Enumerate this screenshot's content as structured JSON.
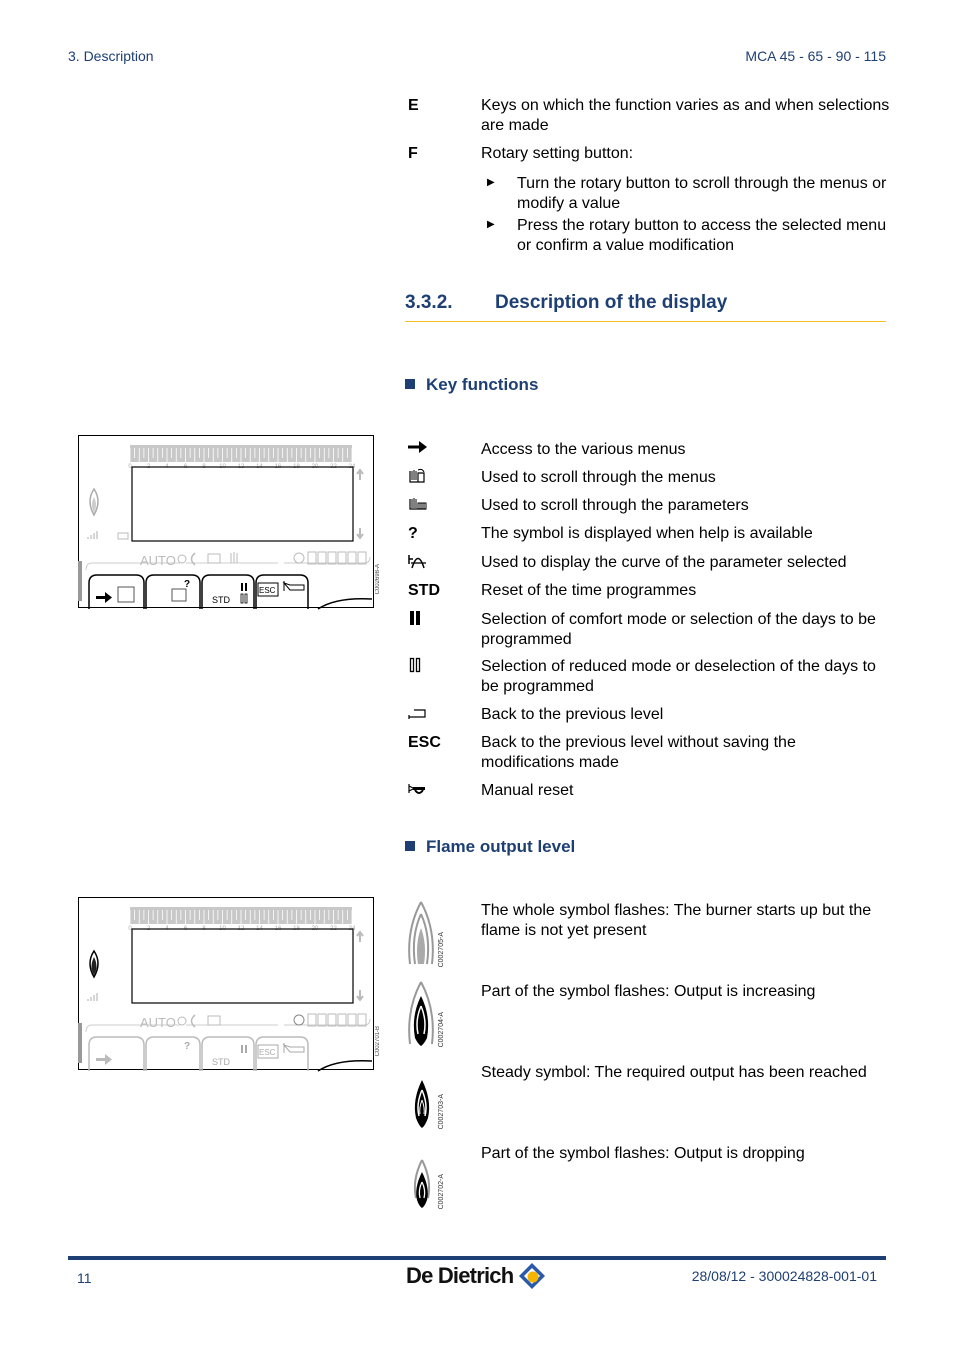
{
  "header": {
    "section": "3.  Description",
    "model": "MCA 45 - 65 - 90 - 115"
  },
  "top_items": [
    {
      "key": "E",
      "text": "Keys on which the function varies as and when selections are made"
    },
    {
      "key": "F",
      "text": "Rotary setting button:"
    }
  ],
  "rotary_bullets": [
    "Turn the rotary button to scroll through the menus or modify a value",
    "Press the rotary button to access the selected menu or confirm a value modification"
  ],
  "section_heading": {
    "number": "3.3.2.",
    "title": "Description of the display"
  },
  "key_functions": {
    "title": "Key functions",
    "items": [
      {
        "symbol": "arrow-right-icon",
        "label": "",
        "text": "Access to the various menus"
      },
      {
        "symbol": "scroll-menus-icon",
        "label": "",
        "text": "Used to scroll through the menus"
      },
      {
        "symbol": "scroll-parameters-icon",
        "label": "",
        "text": "Used to scroll through the parameters"
      },
      {
        "symbol": "help-icon",
        "label": "?",
        "text": "The symbol is displayed when help is available"
      },
      {
        "symbol": "curve-icon",
        "label": "",
        "text": "Used to display the curve of the parameter selected"
      },
      {
        "symbol": "std-label",
        "label": "STD",
        "text": "Reset of the time programmes"
      },
      {
        "symbol": "comfort-mode-icon",
        "label": "",
        "text": "Selection of comfort mode or selection of the days to be programmed"
      },
      {
        "symbol": "reduced-mode-icon",
        "label": "",
        "text": "Selection of reduced mode or deselection of the days to be programmed"
      },
      {
        "symbol": "back-icon",
        "label": "",
        "text": "Back to the previous level"
      },
      {
        "symbol": "esc-label",
        "label": "ESC",
        "text": "Back to the previous level without saving the modifications made"
      },
      {
        "symbol": "manual-reset-icon",
        "label": "",
        "text": "Manual reset"
      }
    ]
  },
  "display_panel_1": {
    "time_ticks": [
      "0",
      "2",
      "4",
      "6",
      "8",
      "10",
      "12",
      "14",
      "16",
      "18",
      "20",
      "22",
      "24"
    ],
    "mode_text": "AUTO",
    "buttons": [
      "",
      "?",
      "STD",
      "ESC"
    ],
    "caption": "C002698-A"
  },
  "display_panel_2": {
    "time_ticks": [
      "0",
      "2",
      "4",
      "6",
      "8",
      "10",
      "12",
      "14",
      "16",
      "18",
      "20",
      "22",
      "24"
    ],
    "mode_text": "AUTO",
    "buttons": [
      "",
      "?",
      "STD",
      "ESC"
    ],
    "caption": "C002701-B"
  },
  "flame_output": {
    "title": "Flame output level",
    "items": [
      {
        "caption": "C002705-A",
        "text": "The whole symbol flashes: The burner starts up but the flame is not yet present"
      },
      {
        "caption": "C002704-A",
        "text": "Part of the symbol flashes: Output is increasing"
      },
      {
        "caption": "C002703-A",
        "text": "Steady symbol: The required output has been reached"
      },
      {
        "caption": "C002702-A",
        "text": "Part of the symbol flashes: Output is dropping"
      }
    ]
  },
  "footer": {
    "page": "11",
    "brand": "De Dietrich",
    "doc_ref": "28/08/12  - 300024828-001-01"
  },
  "colors": {
    "brand_blue": "#1d3f73",
    "rule_yellow": "#f0c020",
    "logo_orange": "#f5b400"
  }
}
